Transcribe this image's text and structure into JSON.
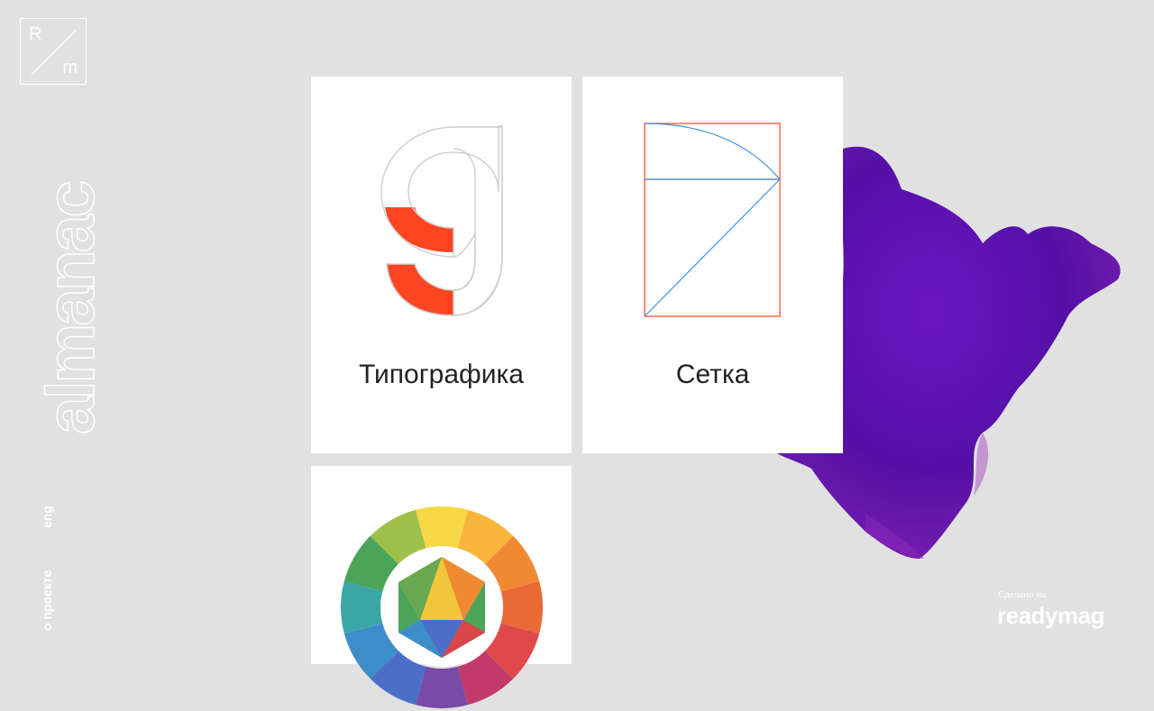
{
  "sidebar": {
    "logo_top": "R",
    "logo_bottom": "m",
    "wordmark": "almanac",
    "about_link": "о проекте",
    "lang_link": "eng"
  },
  "cards": [
    {
      "title": "Типографика",
      "icon": "typography-g-icon"
    },
    {
      "title": "Сетка",
      "icon": "grid-golden-ratio-icon"
    },
    {
      "title": "",
      "icon": "color-wheel-icon"
    }
  ],
  "badge": {
    "made_on": "Сделано на",
    "brand": "readymag"
  },
  "colors": {
    "background": "#e1e1e1",
    "card": "#ffffff",
    "accent_red": "#fd4521",
    "grid_blue": "#3c8fe3",
    "smoke_purple": "#5b0ea8"
  }
}
